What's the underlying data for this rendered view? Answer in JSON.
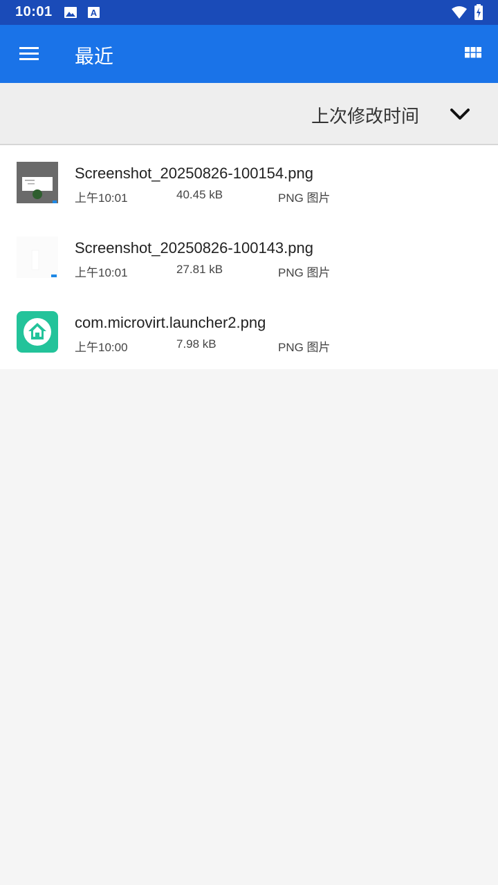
{
  "status_bar": {
    "time": "10:01",
    "left_icons": [
      "image-icon",
      "a-letter-icon"
    ],
    "right_icons": [
      "wifi-icon",
      "battery-icon"
    ]
  },
  "app_bar": {
    "title": "最近",
    "menu_icon": "menu-icon",
    "view_icon": "grid-view-icon",
    "color": "#1a73e8"
  },
  "sort_bar": {
    "label": "上次修改时间",
    "icon": "chevron-down-icon"
  },
  "files": [
    {
      "name": "Screenshot_20250826-100154.png",
      "time": "上午10:01",
      "size": "40.45 kB",
      "type": "PNG 图片",
      "thumbnail": "screenshot-thumbnail"
    },
    {
      "name": "Screenshot_20250826-100143.png",
      "time": "上午10:01",
      "size": "27.81 kB",
      "type": "PNG 图片",
      "thumbnail": "screenshot-thumbnail"
    },
    {
      "name": "com.microvirt.launcher2.png",
      "time": "上午10:00",
      "size": "7.98 kB",
      "type": "PNG 图片",
      "thumbnail": "launcher-app-icon"
    }
  ]
}
